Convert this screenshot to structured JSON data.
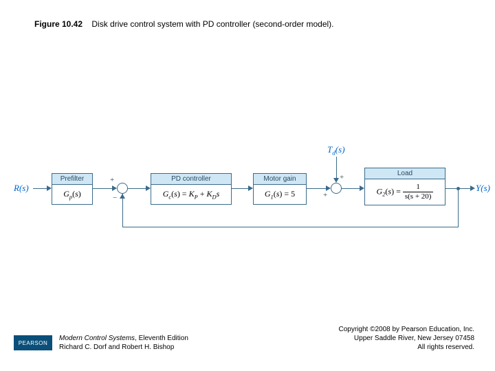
{
  "figure": {
    "number": "Figure 10.42",
    "caption": "Disk drive control system with PD controller (second-order model)."
  },
  "signals": {
    "input": "R(s)",
    "disturbance": "T_d(s)",
    "output": "Y(s)"
  },
  "blocks": {
    "prefilter": {
      "title": "Prefilter",
      "tf": "G_p(s)"
    },
    "pd": {
      "title": "PD controller",
      "tf": "G_c(s) = K_P + K_D s"
    },
    "motor": {
      "title": "Motor gain",
      "tf": "G_1(s) = 5"
    },
    "load": {
      "title": "Load",
      "tf_lhs": "G_2(s) =",
      "tf_num": "1",
      "tf_den": "s(s + 20)"
    }
  },
  "sums": {
    "s1": {
      "top": "+",
      "bottom": "−"
    },
    "s2": {
      "left": "+",
      "top": "+"
    }
  },
  "footer": {
    "logo": "PEARSON",
    "book_title": "Modern Control Systems",
    "book_edition": ", Eleventh Edition",
    "authors": "Richard C. Dorf and Robert H. Bishop",
    "copyright_line1": "Copyright ©2008 by Pearson Education, Inc.",
    "copyright_line2": "Upper Saddle River, New Jersey 07458",
    "copyright_line3": "All rights reserved."
  }
}
